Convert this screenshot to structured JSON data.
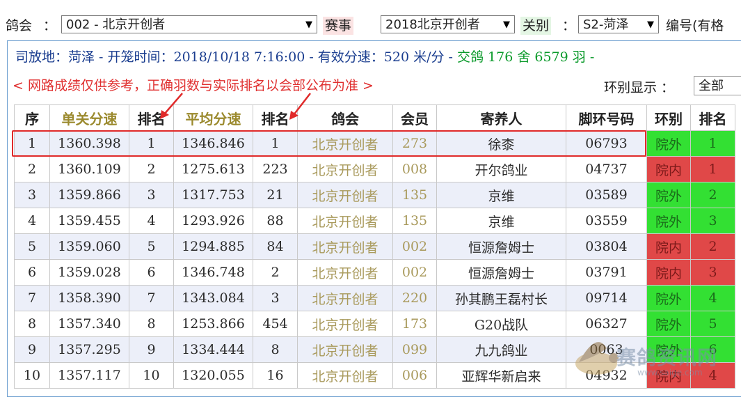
{
  "filters": {
    "club_label": "鸽会",
    "club_colon": "：",
    "club_value": "002 - 北京开创者",
    "race_label": "赛事",
    "race_value": "2018北京开创者",
    "leg_label": "关别",
    "leg_colon": "：",
    "leg_value": "S2-菏泽",
    "ring_label": "编号(有格"
  },
  "info": {
    "release_text": "司放地：菏泽 - 开笼时间：2018/10/18 7:16:00 - 有效分速：520 米/分 - ",
    "loft_text": "交鸽 176 舍 6579 羽 -"
  },
  "notice": "< 网路成绩仅供参考，正确羽数与实际排名以会部公布为准 >",
  "ring_display": {
    "label": "环别显示 ：",
    "value": "全部"
  },
  "table": {
    "headers": [
      "序",
      "单关分速",
      "排名",
      "平均分速",
      "排名",
      "鸽会",
      "会员",
      "寄养人",
      "脚环号码",
      "环别",
      "排名"
    ],
    "rows": [
      [
        "1",
        "1360.398",
        "1",
        "1346.846",
        "1",
        "北京开创者",
        "273",
        "徐桼",
        "06793",
        "院外",
        "1"
      ],
      [
        "2",
        "1360.109",
        "2",
        "1275.613",
        "223",
        "北京开创者",
        "008",
        "开尔鸽业",
        "04737",
        "院内",
        "1"
      ],
      [
        "3",
        "1359.866",
        "3",
        "1317.753",
        "21",
        "北京开创者",
        "135",
        "京维",
        "03589",
        "院外",
        "2"
      ],
      [
        "4",
        "1359.455",
        "4",
        "1293.926",
        "88",
        "北京开创者",
        "135",
        "京维",
        "03559",
        "院外",
        "3"
      ],
      [
        "5",
        "1359.060",
        "5",
        "1294.885",
        "84",
        "北京开创者",
        "002",
        "恒源詹姆士",
        "03804",
        "院内",
        "2"
      ],
      [
        "6",
        "1359.028",
        "6",
        "1346.748",
        "2",
        "北京开创者",
        "002",
        "恒源詹姆士",
        "03791",
        "院内",
        "3"
      ],
      [
        "7",
        "1358.390",
        "7",
        "1343.084",
        "3",
        "北京开创者",
        "220",
        "孙其鹏王磊村长",
        "09714",
        "院外",
        "4"
      ],
      [
        "8",
        "1357.340",
        "8",
        "1253.866",
        "454",
        "北京开创者",
        "173",
        "G20战队",
        "06327",
        "院外",
        "5"
      ],
      [
        "9",
        "1357.295",
        "9",
        "1334.444",
        "8",
        "北京开创者",
        "099",
        "九九鸽业",
        "0063",
        "院外",
        "6"
      ],
      [
        "10",
        "1357.117",
        "10",
        "1320.055",
        "16",
        "北京开创者",
        "006",
        "亚辉华新启来",
        "04932",
        "院内",
        "4"
      ]
    ]
  },
  "watermark": {
    "text": "赛鸽资讯网",
    "url": "www.saige.com"
  },
  "colors": {
    "ring_in": "#e04848",
    "ring_out": "#33e033",
    "highlight": "#e02a2a",
    "info_blue": "#1a3d8f",
    "notice_red": "#e03030"
  }
}
